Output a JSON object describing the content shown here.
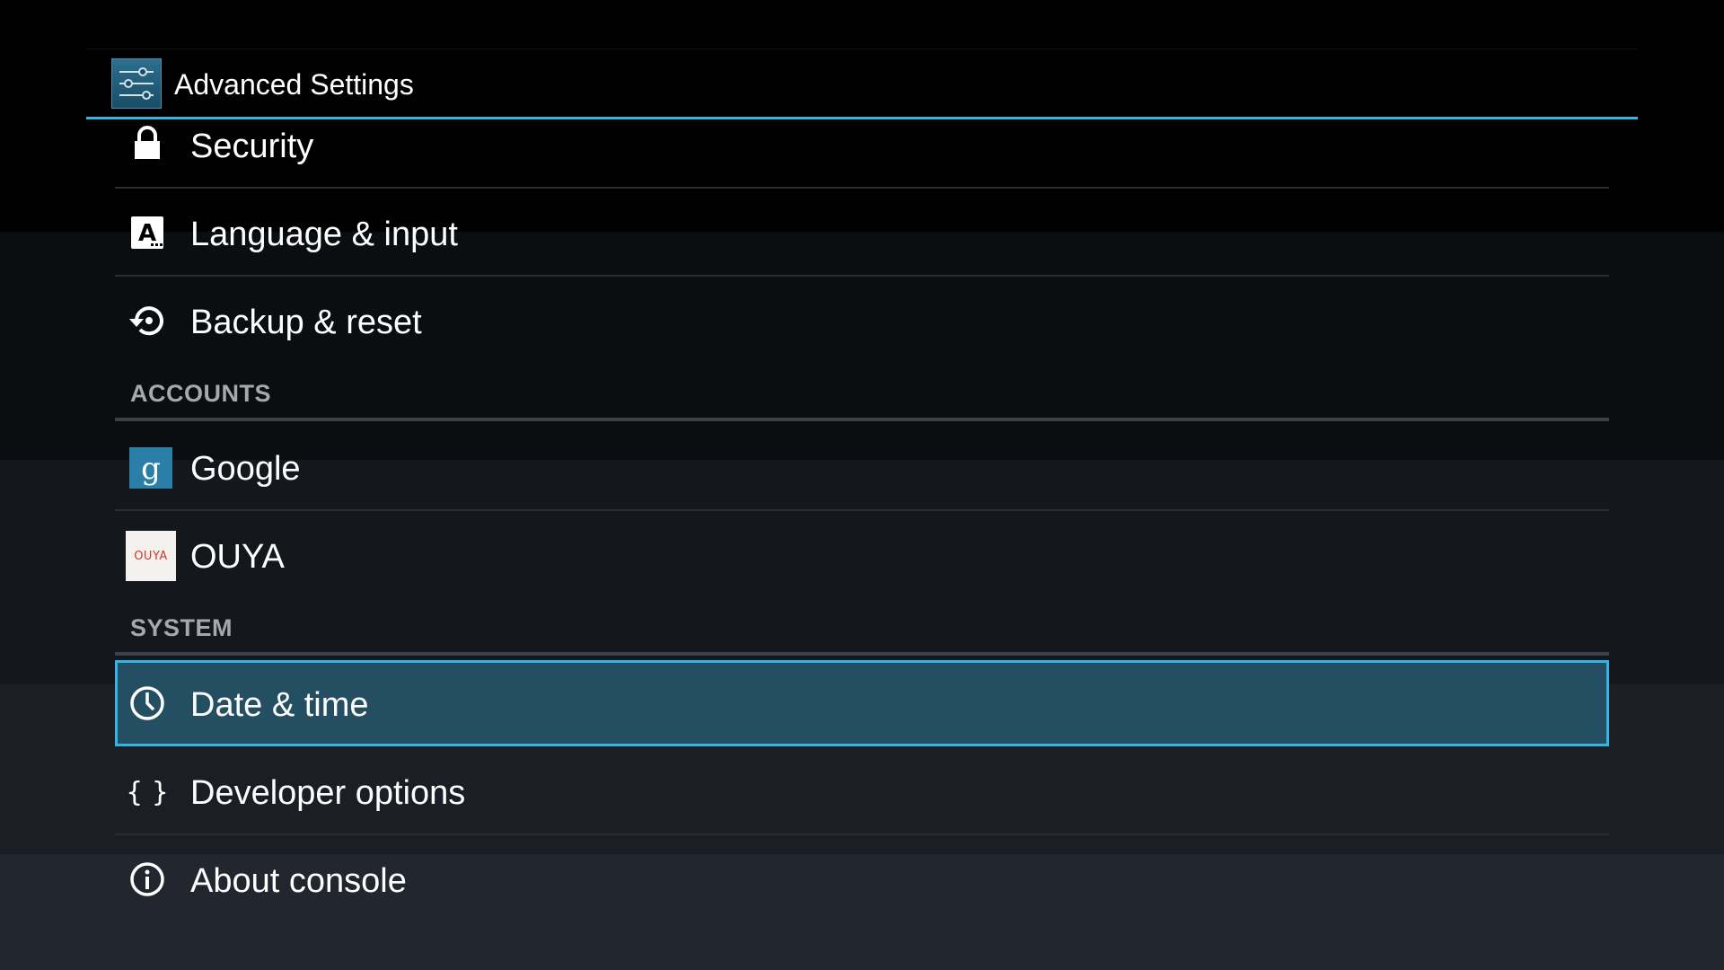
{
  "app": {
    "title": "Advanced Settings",
    "icon": "settings-sliders-icon"
  },
  "sections": {
    "accounts_header": "ACCOUNTS",
    "system_header": "SYSTEM"
  },
  "items": {
    "security": {
      "label": "Security",
      "icon": "lock-icon"
    },
    "language": {
      "label": "Language & input",
      "icon": "language-a-icon"
    },
    "backup": {
      "label": "Backup & reset",
      "icon": "backup-restore-icon"
    },
    "google": {
      "label": "Google",
      "icon": "google-g-icon"
    },
    "ouya": {
      "label": "OUYA",
      "icon": "ouya-logo-icon",
      "logo_text": "OUYA"
    },
    "date_time": {
      "label": "Date & time",
      "icon": "clock-icon",
      "selected": true
    },
    "developer": {
      "label": "Developer options",
      "icon": "braces-icon"
    },
    "about": {
      "label": "About console",
      "icon": "info-icon"
    }
  },
  "colors": {
    "accent": "#33b5e5",
    "selected_row": "#244f62",
    "header_text": "#a6a8ab",
    "google_icon_bg": "#2a7fa8",
    "ouya_red": "#d7362b"
  }
}
